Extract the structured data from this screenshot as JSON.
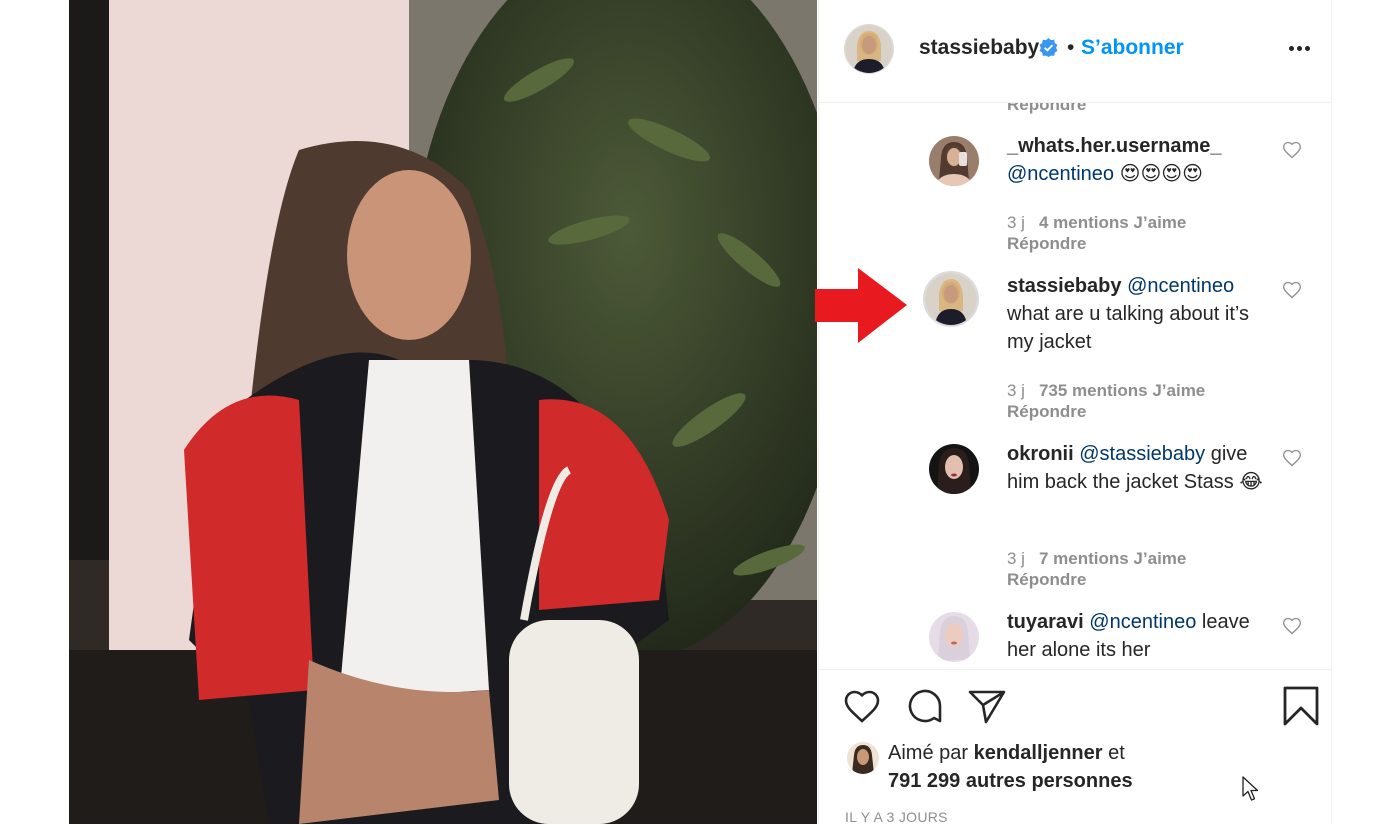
{
  "post": {
    "username": "stassiebaby",
    "separator": "•",
    "follow_label": "S’abonner",
    "more_icon": "more-options-icon"
  },
  "comments": {
    "cut_reply": "Répondre",
    "items": [
      {
        "user": "_whats.her.username_",
        "mention": "@ncentineo",
        "text": "😍😍😍😍",
        "age": "3 j",
        "likes": "4 mentions J’aime",
        "reply": "Répondre"
      },
      {
        "user": "stassiebaby",
        "mention": "@ncentineo",
        "text": "what are u talking about it’s my jacket",
        "age": "3 j",
        "likes": "735 mentions J’aime",
        "reply": "Répondre"
      },
      {
        "user": "okronii",
        "mention": "@stassiebaby",
        "text": "give him back the jacket Stass 😂",
        "age": "3 j",
        "likes": "7 mentions J’aime",
        "reply": "Répondre"
      },
      {
        "user": "tuyaravi",
        "mention": "@ncentineo",
        "text": "leave her alone its her"
      }
    ]
  },
  "footer": {
    "liked_prefix": "Aimé par",
    "liked_user": "kendalljenner",
    "liked_joiner": "et",
    "liked_others": "791 299 autres personnes",
    "time_ago": "IL Y A 3 JOURS"
  },
  "colors": {
    "link_blue": "#0095f6",
    "mention_blue": "#00376b",
    "muted_gray": "#8e8e8e",
    "annotation_arrow": "#e8191f",
    "verified_badge": "#3897f0"
  }
}
